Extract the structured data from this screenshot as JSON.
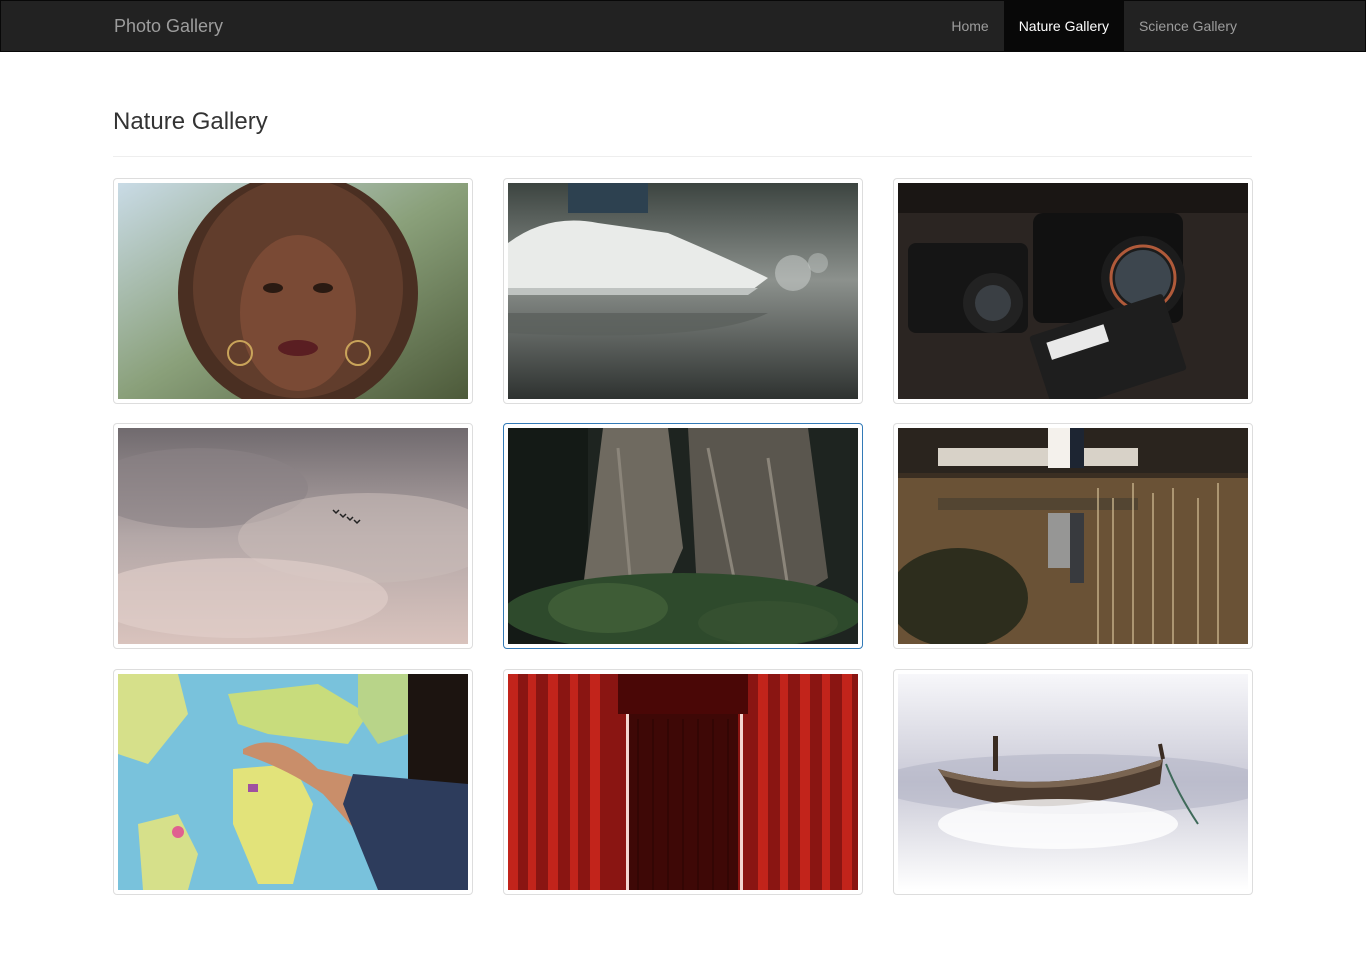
{
  "navbar": {
    "brand": "Photo Gallery",
    "links": [
      {
        "label": "Home",
        "active": false
      },
      {
        "label": "Nature Gallery",
        "active": true
      },
      {
        "label": "Science Gallery",
        "active": false
      }
    ]
  },
  "page": {
    "title": "Nature Gallery"
  },
  "gallery": {
    "photos": [
      {
        "subject": "woman-portrait"
      },
      {
        "subject": "sneakers-splash"
      },
      {
        "subject": "cameras"
      },
      {
        "subject": "cloudy-sky-birds"
      },
      {
        "subject": "forest-tree-trunk"
      },
      {
        "subject": "wedding-dock-reflection"
      },
      {
        "subject": "world-map-hand"
      },
      {
        "subject": "red-corridor"
      },
      {
        "subject": "boat-in-mist"
      }
    ]
  },
  "colors": {
    "navbar_bg": "#222222",
    "nav_active_bg": "#080808",
    "nav_text": "#9d9d9d",
    "hover_border": "#337ab7"
  }
}
